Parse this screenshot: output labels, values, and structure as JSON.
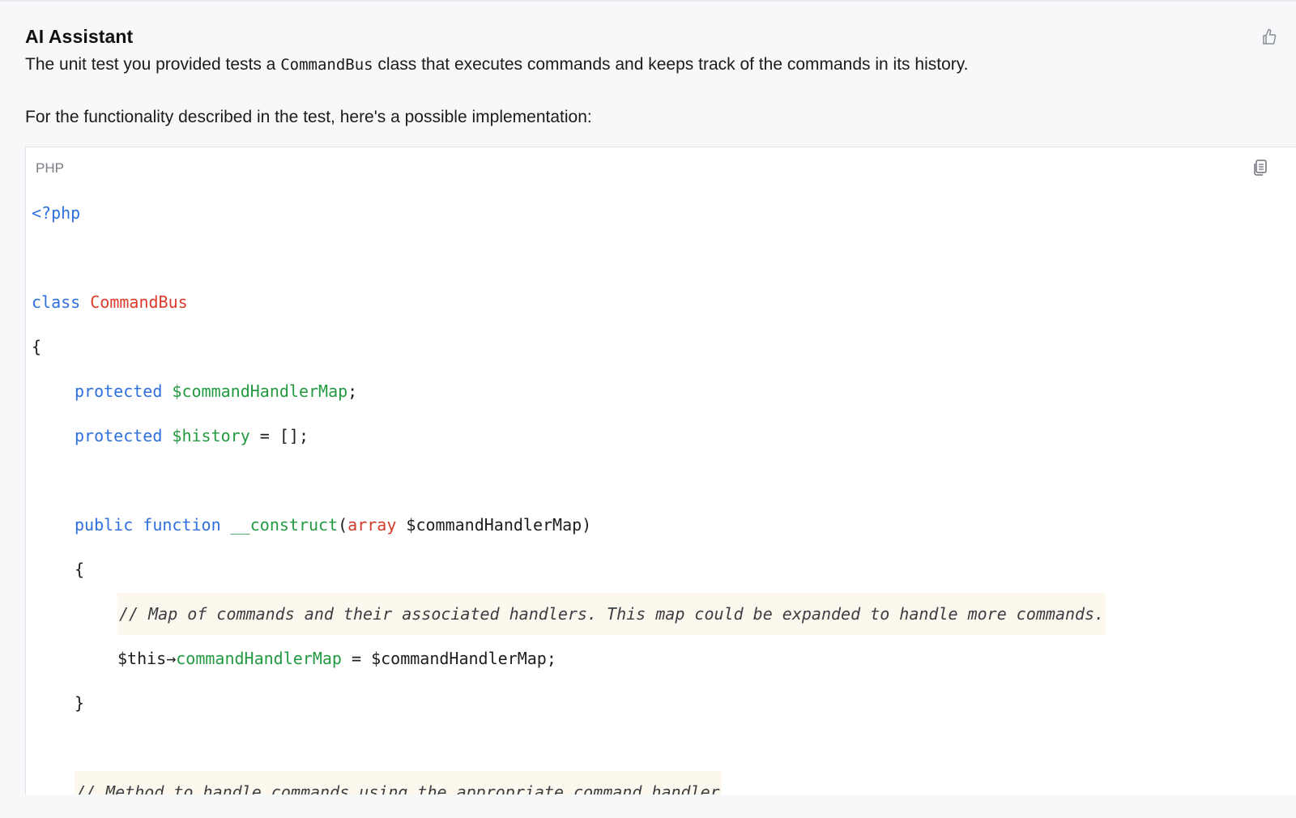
{
  "assistant": {
    "title": "AI Assistant",
    "message_p1_before": "The unit test you provided tests a ",
    "message_p1_code": "CommandBus",
    "message_p1_after": " class that executes commands and keeps track of the commands in its history.",
    "message_p2": "For the functionality described in the test, here's a possible implementation:"
  },
  "icons": {
    "feedback": "thumbs-up-icon",
    "copy": "copy-icon"
  },
  "code_block": {
    "language": "PHP",
    "lines": {
      "l1_open": "<?php",
      "l3_kw": "class",
      "l3_name": "CommandBus",
      "l4": "{",
      "l5_kw": "protected",
      "l5_var": "$commandHandlerMap",
      "l5_end": ";",
      "l6_kw": "protected",
      "l6_var": "$history",
      "l6_end": " = [];",
      "l8_kw1": "public",
      "l8_kw2": "function",
      "l8_fn": "__construct",
      "l8_paren": "(",
      "l8_type": "array",
      "l8_param": " $commandHandlerMap)",
      "l9": "{",
      "l10_comment": "// Map of commands and their associated handlers. This map could be expanded to handle more commands.",
      "l11_this": "$this→",
      "l11_prop": "commandHandlerMap",
      "l11_end": " = $commandHandlerMap;",
      "l12": "}",
      "l14_comment": "// Method to handle commands using the appropriate command handler"
    }
  },
  "colors": {
    "keyword": "#2f6fde",
    "class_name": "#dc3b2b",
    "variable": "#239a41",
    "comment_highlight": "#fdf8ee",
    "panel_bg": "#f7f8fa"
  }
}
